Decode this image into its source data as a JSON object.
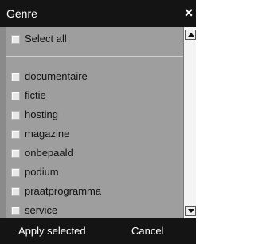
{
  "dialog": {
    "title": "Genre",
    "close_glyph": "×"
  },
  "filter": {
    "select_all_label": "Select all",
    "items": [
      {
        "label": "documentaire",
        "checked": false
      },
      {
        "label": "fictie",
        "checked": false
      },
      {
        "label": "hosting",
        "checked": false
      },
      {
        "label": "magazine",
        "checked": false
      },
      {
        "label": "onbepaald",
        "checked": false
      },
      {
        "label": "podium",
        "checked": false
      },
      {
        "label": "praatprogramma",
        "checked": false
      },
      {
        "label": "service",
        "checked": false
      }
    ]
  },
  "footer": {
    "apply_label": "Apply selected",
    "cancel_label": "Cancel"
  },
  "icons": {
    "close": "close-icon",
    "scroll_up": "chevron-up-icon",
    "scroll_down": "chevron-down-icon"
  },
  "colors": {
    "title_bar": "#141414",
    "panel": "#9e9e9e",
    "text_light": "#ffffff",
    "text_dark": "#111111"
  }
}
